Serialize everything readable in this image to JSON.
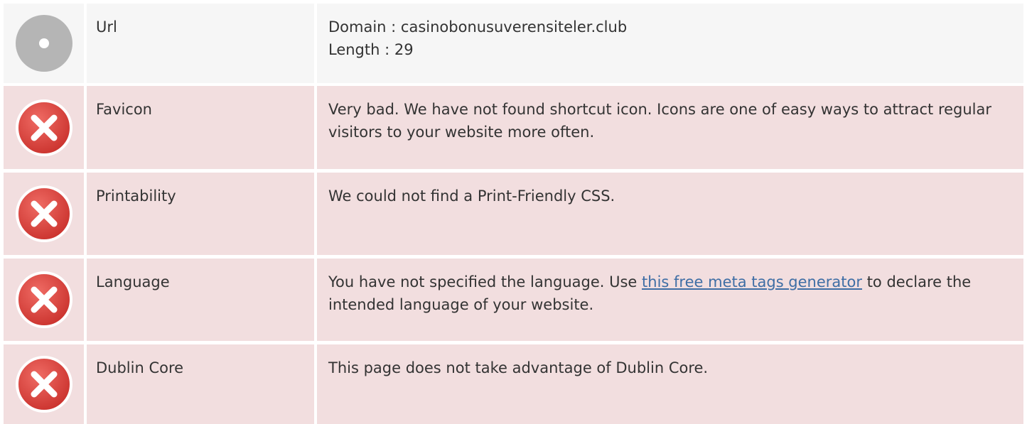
{
  "rows": [
    {
      "status": "neutral",
      "icon": "neutral-circle-icon",
      "label": "Url",
      "lines": [
        "Domain : casinobonusuverensiteler.club",
        "Length : 29"
      ]
    },
    {
      "status": "error",
      "icon": "error-x-icon",
      "label": "Favicon",
      "text": "Very bad. We have not found shortcut icon. Icons are one of easy ways to attract regular visitors to your website more often."
    },
    {
      "status": "error",
      "icon": "error-x-icon",
      "label": "Printability",
      "text": "We could not find a Print-Friendly CSS."
    },
    {
      "status": "error",
      "icon": "error-x-icon",
      "label": "Language",
      "text_before": "You have not specified the language. Use ",
      "link_text": "this free meta tags generator",
      "text_after": " to declare the intended language of your website."
    },
    {
      "status": "error",
      "icon": "error-x-icon",
      "label": "Dublin Core",
      "text": "This page does not take advantage of Dublin Core."
    }
  ],
  "colors": {
    "neutral_bg": "#f6f6f6",
    "error_bg": "#f2dedf",
    "error_icon": "#d9443f",
    "neutral_icon": "#b5b5b5",
    "link": "#3f6ea5"
  }
}
